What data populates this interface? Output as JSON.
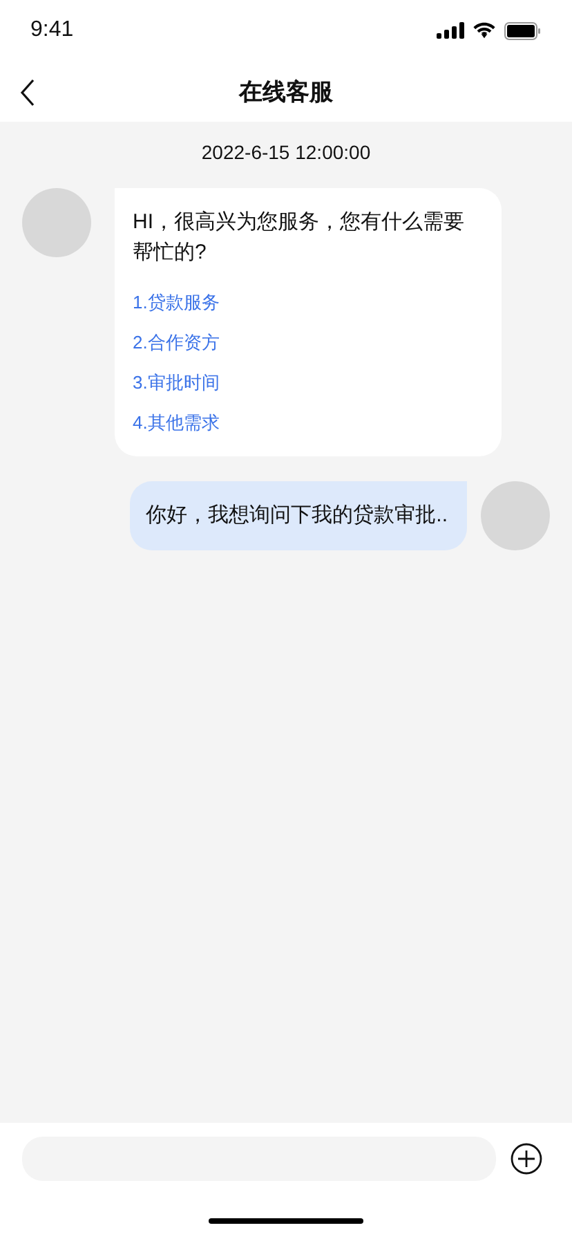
{
  "status_bar": {
    "time": "9:41"
  },
  "nav": {
    "title": "在线客服"
  },
  "timestamp": "2022-6-15 12:00:00",
  "messages": [
    {
      "kind": "agent",
      "text": "HI，很高兴为您服务，您有什么需要帮忙的?",
      "options": [
        "1.贷款服务",
        "2.合作资方",
        "3.审批时间",
        "4.其他需求"
      ]
    },
    {
      "kind": "user",
      "text": "你好，我想询问下我的贷款审批.."
    }
  ]
}
